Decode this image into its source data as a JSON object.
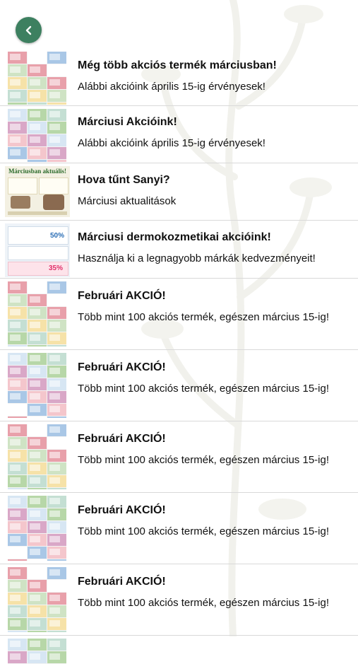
{
  "nav": {
    "back_icon": "chevron-left-icon"
  },
  "colors": {
    "accent": "#3d8060",
    "divider": "#d9d9d9"
  },
  "items": [
    {
      "title": "Még több akciós termék márciusban!",
      "subtitle": "Alábbi akcióink április 15-ig érvényesek!"
    },
    {
      "title": "Márciusi Akcióink!",
      "subtitle": "Alábbi akcióink április 15-ig érvényesek!"
    },
    {
      "title": "Hova tűnt Sanyi?",
      "subtitle": "Márciusi aktualitások",
      "thumb_text": "Márciusban aktuális!"
    },
    {
      "title": "Márciusi dermokozmetikai akcióink!",
      "subtitle": "Használja ki a legnagyobb márkák kedvezményeit!",
      "thumb_text": [
        "50%",
        "35%"
      ]
    },
    {
      "title": "Februári AKCIÓ!",
      "subtitle": "Több mint 100 akciós termék, egészen március 15-ig!"
    },
    {
      "title": "Februári AKCIÓ!",
      "subtitle": "Több mint 100 akciós termék, egészen március 15-ig!"
    },
    {
      "title": "Februári AKCIÓ!",
      "subtitle": "Több mint 100 akciós termék, egészen március 15-ig!"
    },
    {
      "title": "Februári AKCIÓ!",
      "subtitle": "Több mint 100 akciós termék, egészen március 15-ig!"
    },
    {
      "title": "Februári AKCIÓ!",
      "subtitle": "Több mint 100 akciós termék, egészen március 15-ig!"
    }
  ]
}
